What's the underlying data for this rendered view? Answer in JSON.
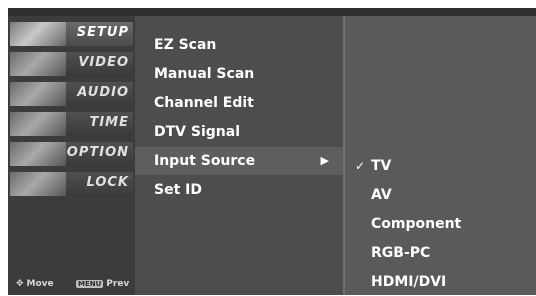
{
  "sidebar": {
    "items": [
      {
        "label": "SETUP",
        "icon": "satellite-dish-icon"
      },
      {
        "label": "VIDEO",
        "icon": "film-reel-icon"
      },
      {
        "label": "AUDIO",
        "icon": "speaker-icon"
      },
      {
        "label": "TIME",
        "icon": "clock-icon"
      },
      {
        "label": "OPTION",
        "icon": "option-badge-icon"
      },
      {
        "label": "LOCK",
        "icon": "lock-icon"
      }
    ],
    "hint_move": "Move",
    "hint_menu_key": "MENU",
    "hint_prev": "Prev"
  },
  "menu": {
    "items": [
      {
        "label": "EZ Scan"
      },
      {
        "label": "Manual Scan"
      },
      {
        "label": "Channel Edit"
      },
      {
        "label": "DTV Signal"
      },
      {
        "label": "Input Source",
        "arrow": "▶"
      },
      {
        "label": "Set ID"
      }
    ]
  },
  "submenu": {
    "items": [
      {
        "label": "TV",
        "check": "✓"
      },
      {
        "label": "AV"
      },
      {
        "label": "Component"
      },
      {
        "label": "RGB-PC"
      },
      {
        "label": "HDMI/DVI"
      }
    ]
  }
}
